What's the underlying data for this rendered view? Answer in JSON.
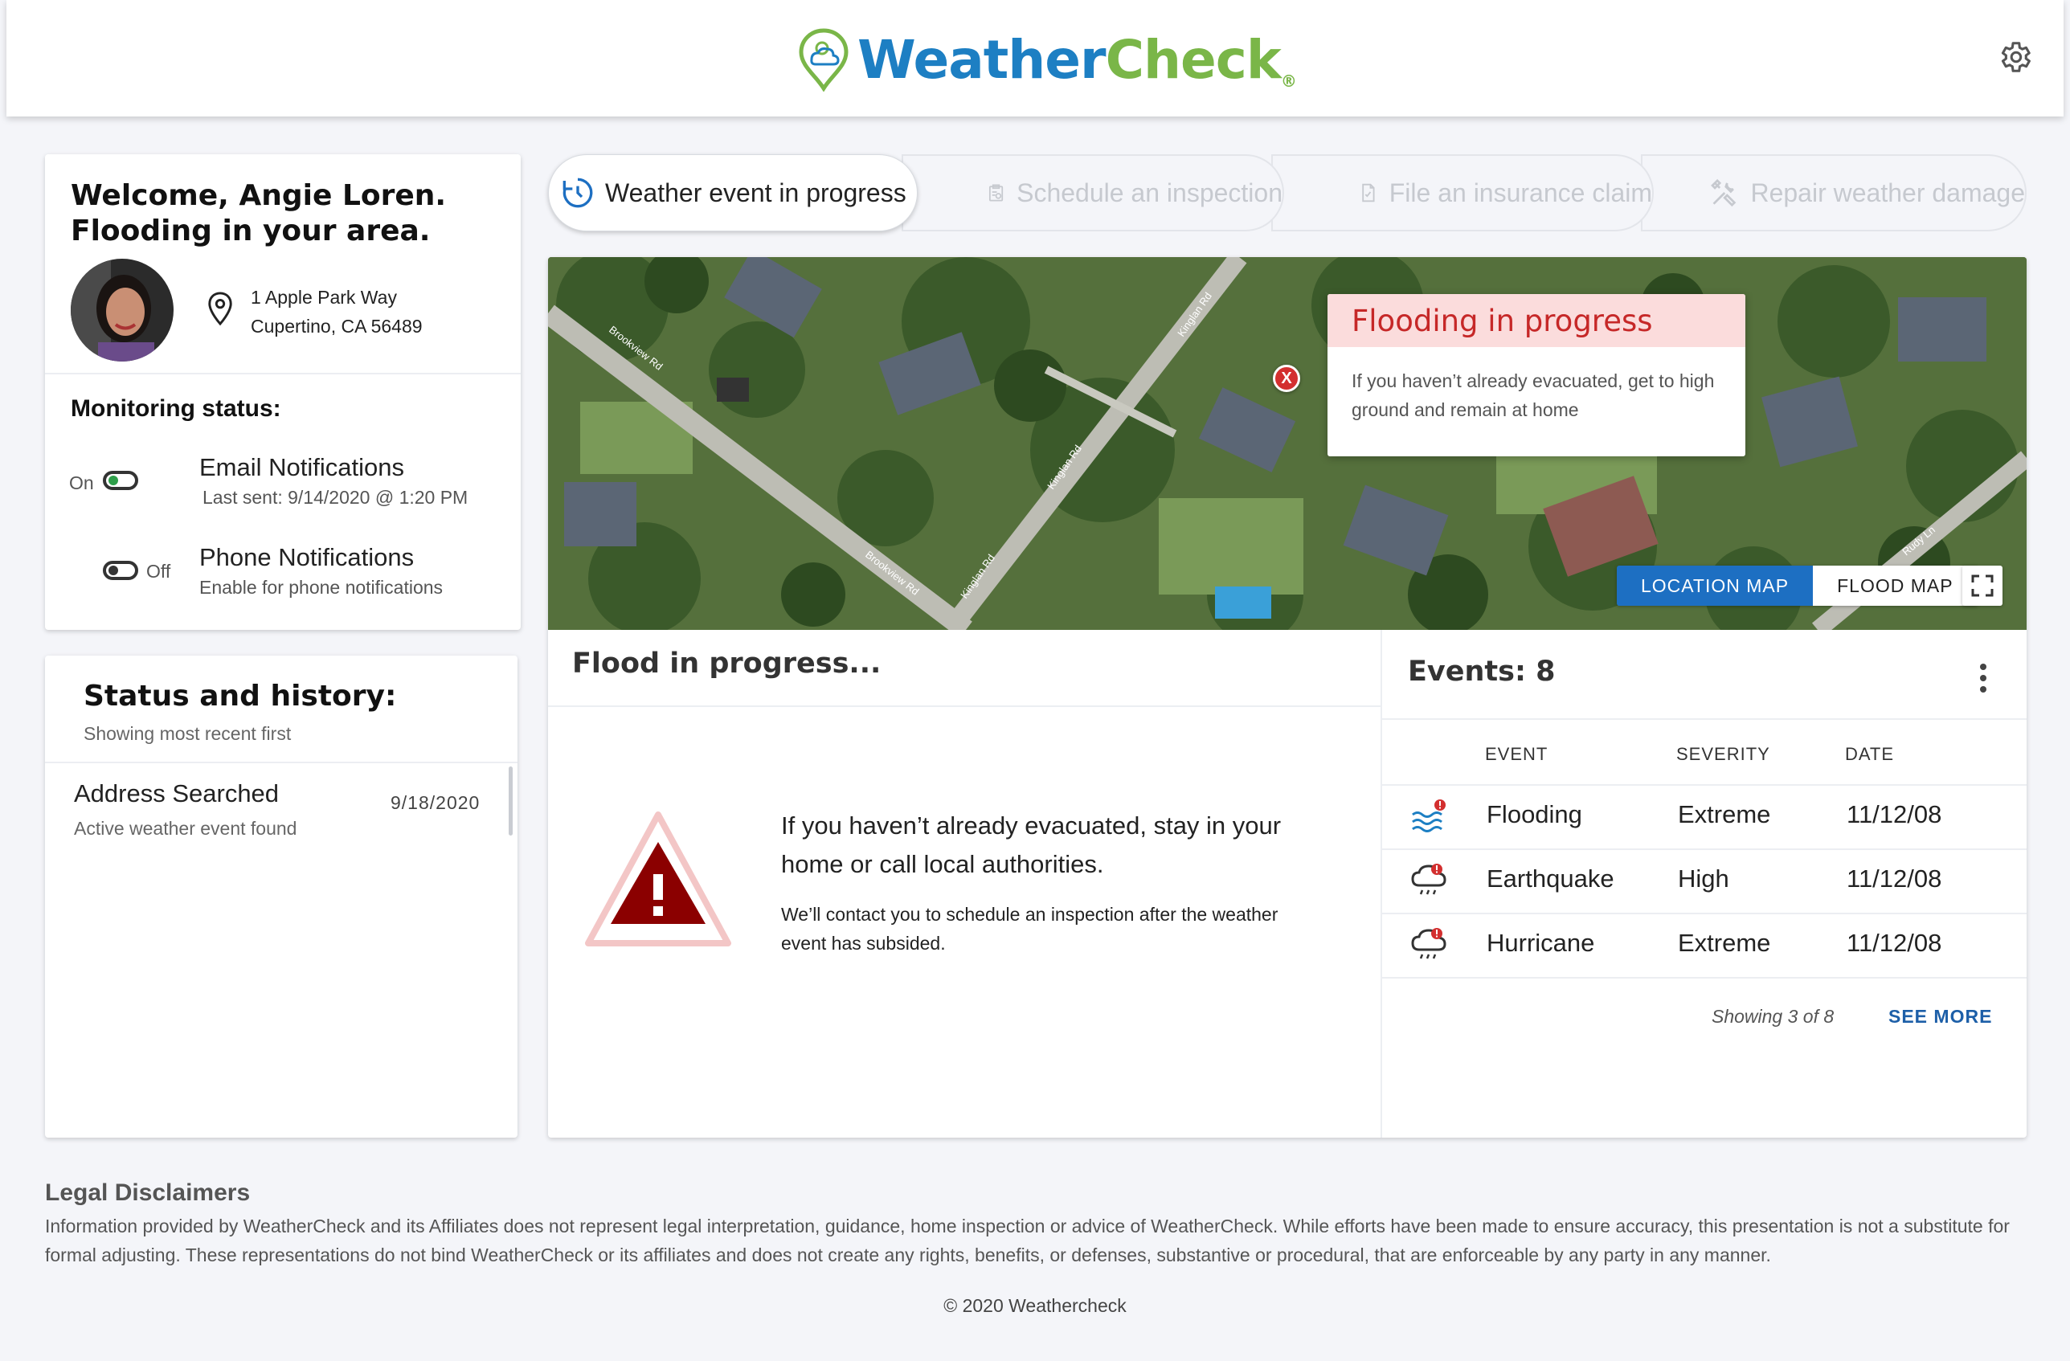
{
  "header": {
    "logo_part1": "Weather",
    "logo_part2": "Check",
    "logo_mark": "®"
  },
  "welcome": {
    "line1": "Welcome, Angie Loren.",
    "line2": "Flooding in your area.",
    "address_line1": "1 Apple Park Way",
    "address_line2": "Cupertino, CA 56489"
  },
  "monitoring": {
    "title": "Monitoring status:",
    "email": {
      "state_label": "On",
      "title": "Email Notifications",
      "subtitle": "Last sent: 9/14/2020 @ 1:20 PM",
      "enabled": true
    },
    "phone": {
      "state_label": "Off",
      "title": "Phone Notifications",
      "subtitle": "Enable for phone notifications",
      "enabled": false
    }
  },
  "history": {
    "title": "Status and history:",
    "subtitle": "Showing most recent first",
    "items": [
      {
        "title": "Address Searched",
        "subtitle": "Active weather event found",
        "date": "9/18/2020"
      }
    ]
  },
  "tabs": [
    {
      "label": "Weather event in progress",
      "icon": "clock-icon",
      "active": true
    },
    {
      "label": "Schedule an inspection",
      "icon": "clipboard-icon",
      "active": false
    },
    {
      "label": "File an insurance claim",
      "icon": "document-check-icon",
      "active": false
    },
    {
      "label": "Repair weather damage",
      "icon": "tools-icon",
      "active": false
    }
  ],
  "map": {
    "popup_title": "Flooding in progress",
    "popup_body": "If you haven’t already evacuated, get to high ground and remain at home",
    "marker_label": "X",
    "btn_location": "LOCATION MAP",
    "btn_flood": "FLOOD MAP",
    "roads": [
      "Brookview Rd",
      "Kinglan Rd",
      "Kinglan Rd",
      "Brookview Rd",
      "Kinglan Rd",
      "Rudy Ln"
    ]
  },
  "flood": {
    "title": "Flood in progress...",
    "message": "If you haven’t already evacuated, stay in your home or call local authorities.",
    "sub": "We’ll contact you to schedule an inspection after the weather event has subsided."
  },
  "events": {
    "title": "Events: 8",
    "columns": {
      "event": "EVENT",
      "severity": "SEVERITY",
      "date": "DATE"
    },
    "rows": [
      {
        "event": "Flooding",
        "severity": "Extreme",
        "date": "11/12/08",
        "icon": "flood-alert-icon"
      },
      {
        "event": "Earthquake",
        "severity": "High",
        "date": "11/12/08",
        "icon": "storm-alert-icon"
      },
      {
        "event": "Hurricane",
        "severity": "Extreme",
        "date": "11/12/08",
        "icon": "storm-alert-icon"
      }
    ],
    "showing": "Showing 3 of 8",
    "see_more": "SEE MORE"
  },
  "legal": {
    "title": "Legal Disclaimers",
    "text": "Information provided by WeatherCheck and its Affiliates does not represent legal interpretation, guidance, home inspection or advice of WeatherCheck. While efforts have been made to ensure accuracy, this presentation is not a substitute for formal adjusting. These representations do not bind WeatherCheck or its affiliates and does not create any rights, benefits, or defenses, substantive or procedural, that are enforceable by any party in any manner.",
    "copyright": "© 2020 Weathercheck"
  },
  "colors": {
    "brand_blue": "#1d7fc3",
    "brand_green": "#7ab648",
    "alert_red": "#c62828",
    "popup_header": "#fbdcdc",
    "map_button_active": "#1d6fc2",
    "warning_dark": "#8b0000",
    "link": "#1d5fa8"
  }
}
